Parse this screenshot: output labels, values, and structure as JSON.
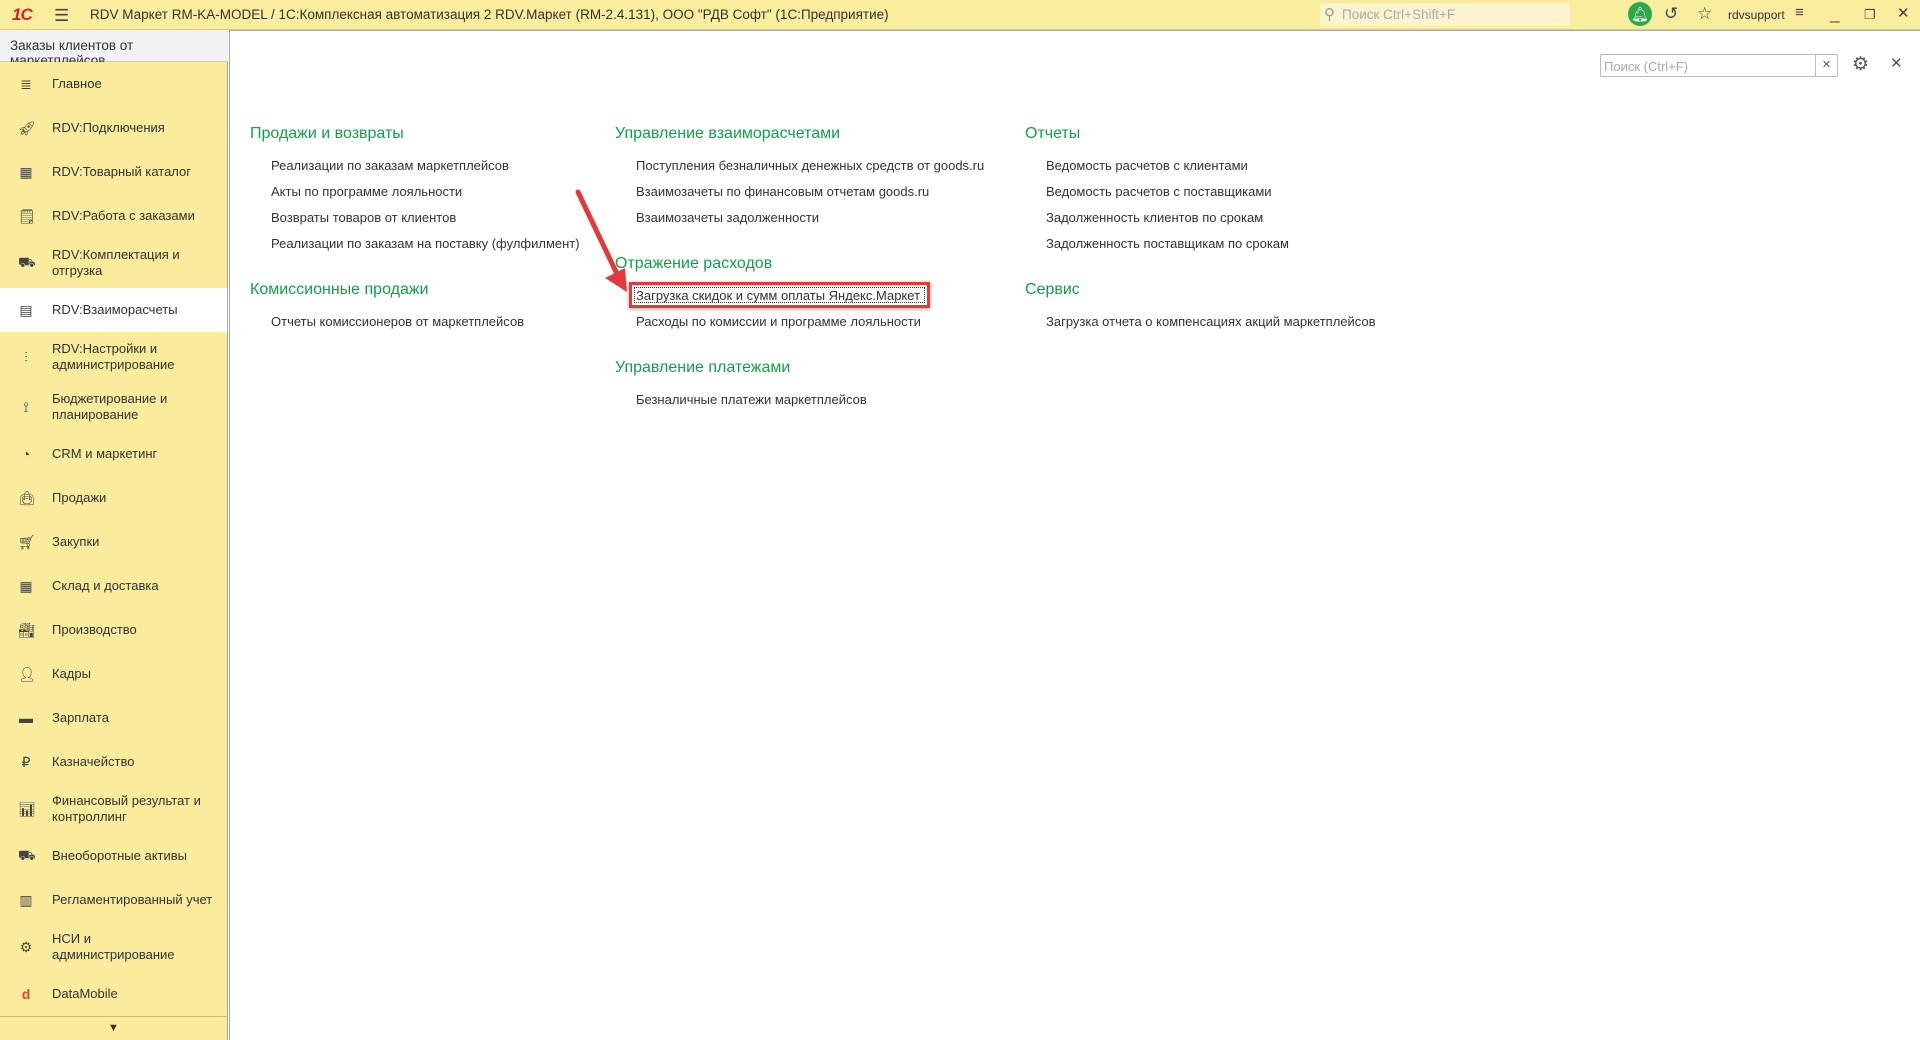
{
  "titlebar": {
    "logo": "1С",
    "title": "RDV Маркет RM-KA-MODEL / 1С:Комплексная автоматизация 2 RDV.Маркет (RM-2.4.131), ООО \"РДВ Софт\"  (1С:Предприятие)",
    "search_placeholder": "Поиск Ctrl+Shift+F",
    "user": "rdvsupport"
  },
  "tab": "Заказы клиентов от маркетплейсов",
  "sidebar": {
    "items": [
      {
        "label": "Главное",
        "icon": "menu-icon"
      },
      {
        "label": "RDV:Подключения",
        "icon": "rocket-icon"
      },
      {
        "label": "RDV:Товарный каталог",
        "icon": "grid-icon"
      },
      {
        "label": "RDV:Работа с заказами",
        "icon": "orders-icon"
      },
      {
        "label": "RDV:Комплектация и отгрузка",
        "icon": "cart-box-icon"
      },
      {
        "label": "RDV:Взаиморасчеты",
        "icon": "calculator-icon",
        "active": true
      },
      {
        "label": "RDV:Настройки и администрирование",
        "icon": "sliders-icon"
      },
      {
        "label": "Бюджетирование и планирование",
        "icon": "budget-icon"
      },
      {
        "label": "CRM и маркетинг",
        "icon": "pie-icon"
      },
      {
        "label": "Продажи",
        "icon": "bag-icon"
      },
      {
        "label": "Закупки",
        "icon": "cart-icon"
      },
      {
        "label": "Склад и доставка",
        "icon": "warehouse-icon"
      },
      {
        "label": "Производство",
        "icon": "factory-icon"
      },
      {
        "label": "Кадры",
        "icon": "person-icon"
      },
      {
        "label": "Зарплата",
        "icon": "card-icon"
      },
      {
        "label": "Казначейство",
        "icon": "ruble-icon"
      },
      {
        "label": "Финансовый результат и контроллинг",
        "icon": "bar-chart-icon"
      },
      {
        "label": "Внеоборотные активы",
        "icon": "truck-icon"
      },
      {
        "label": "Регламентированный учет",
        "icon": "ledger-icon"
      },
      {
        "label": "НСИ и администрирование",
        "icon": "gear-icon"
      },
      {
        "label": "DataMobile",
        "icon": "datamobile-icon"
      }
    ]
  },
  "main": {
    "search_placeholder": "Поиск (Ctrl+F)",
    "sections": [
      {
        "title": "Продажи и возвраты",
        "links": [
          "Реализации по заказам маркетплейсов",
          "Акты по программе лояльности",
          "Возвраты товаров от клиентов",
          "Реализации по заказам на поставку (фулфилмент)"
        ]
      },
      {
        "title": "Комиссионные продажи",
        "links": [
          "Отчеты комиссионеров от маркетплейсов"
        ]
      },
      {
        "title": "Управление взаиморасчетами",
        "links": [
          "Поступления безналичных денежных средств от goods.ru",
          "Взаимозачеты по финансовым отчетам goods.ru",
          "Взаимозачеты задолженности"
        ]
      },
      {
        "title": "Отражение расходов",
        "links": [
          "Загрузка скидок и сумм оплаты Яндекс.Маркет",
          "Расходы по комиссии и программе лояльности"
        ]
      },
      {
        "title": "Управление платежами",
        "links": [
          "Безналичные платежи маркетплейсов"
        ]
      },
      {
        "title": "Отчеты",
        "links": [
          "Ведомость расчетов с клиентами",
          "Ведомость расчетов с поставщиками",
          "Задолженность клиентов по срокам",
          "Задолженность поставщикам по срокам"
        ]
      },
      {
        "title": "Сервис",
        "links": [
          "Загрузка отчета о компенсациях акций маркетплейсов"
        ]
      }
    ]
  }
}
